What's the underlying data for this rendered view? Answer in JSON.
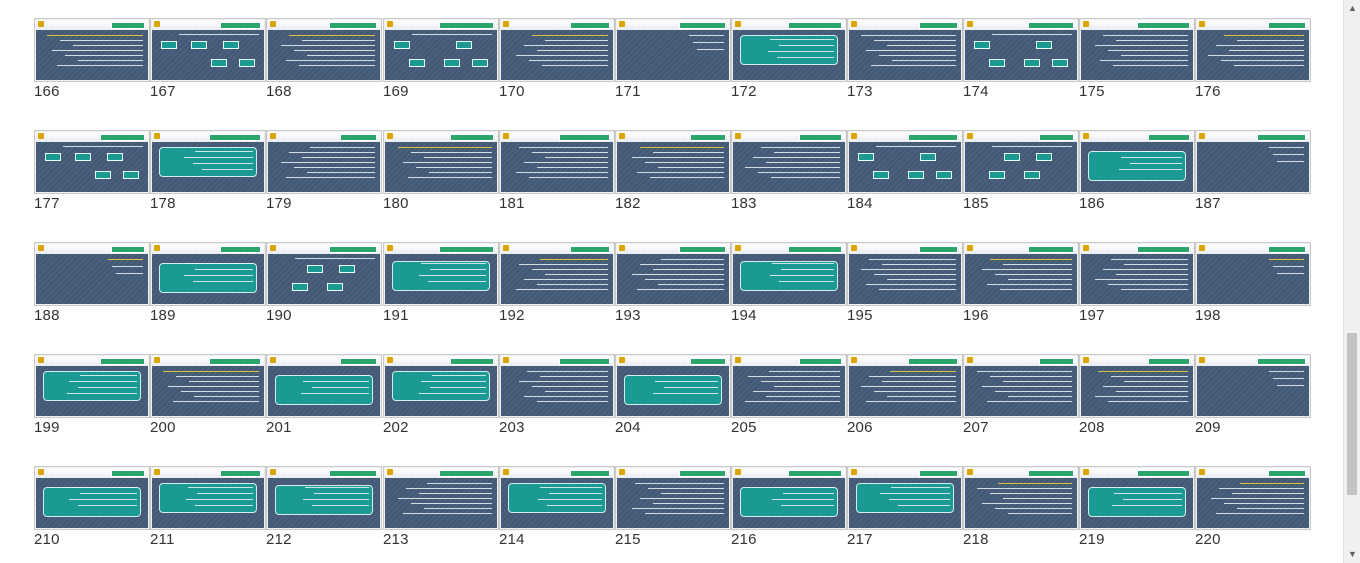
{
  "slides": [
    {
      "number": "166",
      "variant": "text"
    },
    {
      "number": "167",
      "variant": "diagram"
    },
    {
      "number": "168",
      "variant": "text"
    },
    {
      "number": "169",
      "variant": "diagram"
    },
    {
      "number": "170",
      "variant": "text"
    },
    {
      "number": "171",
      "variant": "sparse"
    },
    {
      "number": "172",
      "variant": "box"
    },
    {
      "number": "173",
      "variant": "text"
    },
    {
      "number": "174",
      "variant": "diagram"
    },
    {
      "number": "175",
      "variant": "text"
    },
    {
      "number": "176",
      "variant": "text"
    },
    {
      "number": "177",
      "variant": "diagram"
    },
    {
      "number": "178",
      "variant": "box"
    },
    {
      "number": "179",
      "variant": "text"
    },
    {
      "number": "180",
      "variant": "text"
    },
    {
      "number": "181",
      "variant": "text"
    },
    {
      "number": "182",
      "variant": "text"
    },
    {
      "number": "183",
      "variant": "text"
    },
    {
      "number": "184",
      "variant": "diagram"
    },
    {
      "number": "185",
      "variant": "diagram"
    },
    {
      "number": "186",
      "variant": "box"
    },
    {
      "number": "187",
      "variant": "sparse"
    },
    {
      "number": "188",
      "variant": "sparse"
    },
    {
      "number": "189",
      "variant": "box"
    },
    {
      "number": "190",
      "variant": "diagram"
    },
    {
      "number": "191",
      "variant": "box"
    },
    {
      "number": "192",
      "variant": "text"
    },
    {
      "number": "193",
      "variant": "text"
    },
    {
      "number": "194",
      "variant": "box"
    },
    {
      "number": "195",
      "variant": "text"
    },
    {
      "number": "196",
      "variant": "text"
    },
    {
      "number": "197",
      "variant": "text"
    },
    {
      "number": "198",
      "variant": "sparse"
    },
    {
      "number": "199",
      "variant": "box"
    },
    {
      "number": "200",
      "variant": "text"
    },
    {
      "number": "201",
      "variant": "box"
    },
    {
      "number": "202",
      "variant": "box"
    },
    {
      "number": "203",
      "variant": "text"
    },
    {
      "number": "204",
      "variant": "box"
    },
    {
      "number": "205",
      "variant": "text"
    },
    {
      "number": "206",
      "variant": "text"
    },
    {
      "number": "207",
      "variant": "text"
    },
    {
      "number": "208",
      "variant": "text"
    },
    {
      "number": "209",
      "variant": "sparse"
    },
    {
      "number": "210",
      "variant": "box"
    },
    {
      "number": "211",
      "variant": "box"
    },
    {
      "number": "212",
      "variant": "box"
    },
    {
      "number": "213",
      "variant": "text"
    },
    {
      "number": "214",
      "variant": "box"
    },
    {
      "number": "215",
      "variant": "text"
    },
    {
      "number": "216",
      "variant": "box"
    },
    {
      "number": "217",
      "variant": "box"
    },
    {
      "number": "218",
      "variant": "text"
    },
    {
      "number": "219",
      "variant": "box"
    },
    {
      "number": "220",
      "variant": "text"
    }
  ],
  "scrollbar": {
    "up_icon": "▲",
    "down_icon": "▼",
    "position": 0.86
  }
}
